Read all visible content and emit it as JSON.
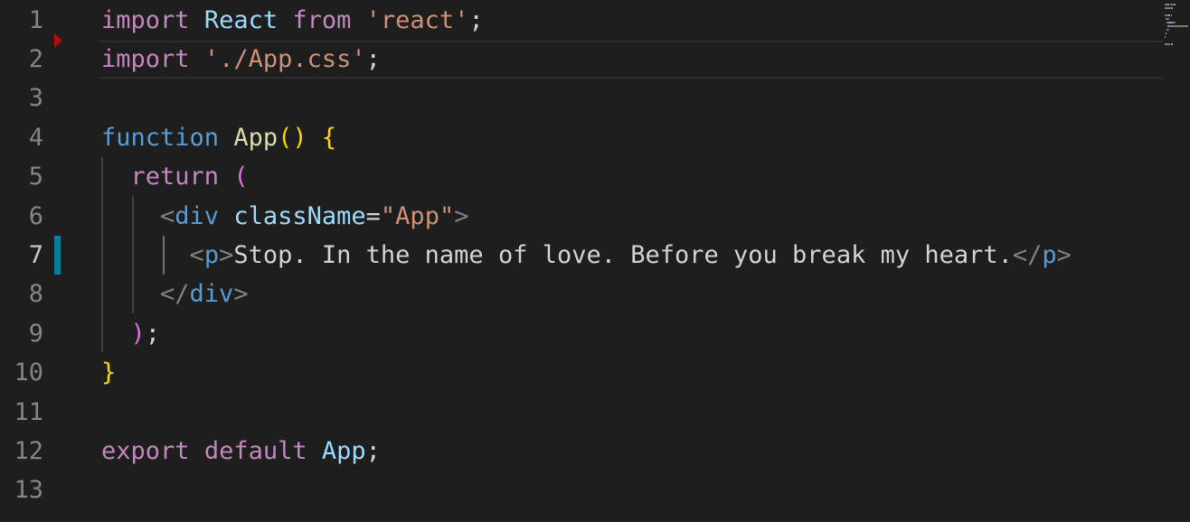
{
  "editor": {
    "active_line": 7,
    "colors": {
      "background": "#1e1e1e",
      "line_number": "#858585",
      "keyword": "#c586c0",
      "declaration": "#569cd6",
      "variable": "#9cdcfe",
      "function": "#dcdcaa",
      "string": "#ce9178",
      "bracket_level_1": "#ffd700",
      "bracket_level_2": "#da70d6",
      "breakpoint": "#b10d0d",
      "git_modified": "#0c7d9d"
    },
    "line_numbers": [
      "1",
      "2",
      "3",
      "4",
      "5",
      "6",
      "7",
      "8",
      "9",
      "10",
      "11",
      "12",
      "13"
    ],
    "lines": [
      {
        "tokens": [
          {
            "t": "keyword",
            "v": "import"
          },
          {
            "t": "text",
            "v": " "
          },
          {
            "t": "var",
            "v": "React"
          },
          {
            "t": "text",
            "v": " "
          },
          {
            "t": "keyword",
            "v": "from"
          },
          {
            "t": "text",
            "v": " "
          },
          {
            "t": "string",
            "v": "'react'"
          },
          {
            "t": "punct",
            "v": ";"
          }
        ]
      },
      {
        "tokens": [
          {
            "t": "keyword",
            "v": "import"
          },
          {
            "t": "text",
            "v": " "
          },
          {
            "t": "string",
            "v": "'./App.css'"
          },
          {
            "t": "punct",
            "v": ";"
          }
        ]
      },
      {
        "tokens": []
      },
      {
        "tokens": [
          {
            "t": "decl",
            "v": "function"
          },
          {
            "t": "text",
            "v": " "
          },
          {
            "t": "func",
            "v": "App"
          },
          {
            "t": "bracket1",
            "v": "()"
          },
          {
            "t": "text",
            "v": " "
          },
          {
            "t": "bracket1",
            "v": "{"
          }
        ]
      },
      {
        "tokens": [
          {
            "t": "text",
            "v": "  "
          },
          {
            "t": "keyword",
            "v": "return"
          },
          {
            "t": "text",
            "v": " "
          },
          {
            "t": "bracket2",
            "v": "("
          }
        ]
      },
      {
        "tokens": [
          {
            "t": "text",
            "v": "    "
          },
          {
            "t": "tag-bracket",
            "v": "<"
          },
          {
            "t": "tag",
            "v": "div"
          },
          {
            "t": "text",
            "v": " "
          },
          {
            "t": "attr",
            "v": "className"
          },
          {
            "t": "punct",
            "v": "="
          },
          {
            "t": "string",
            "v": "\"App\""
          },
          {
            "t": "tag-bracket",
            "v": ">"
          }
        ]
      },
      {
        "tokens": [
          {
            "t": "text",
            "v": "      "
          },
          {
            "t": "tag-bracket",
            "v": "<"
          },
          {
            "t": "tag",
            "v": "p"
          },
          {
            "t": "tag-bracket",
            "v": ">"
          },
          {
            "t": "text",
            "v": "Stop. In the name of love. Before you break my heart."
          },
          {
            "t": "tag-bracket",
            "v": "</"
          },
          {
            "t": "tag",
            "v": "p"
          },
          {
            "t": "tag-bracket",
            "v": ">"
          }
        ]
      },
      {
        "tokens": [
          {
            "t": "text",
            "v": "    "
          },
          {
            "t": "tag-bracket",
            "v": "</"
          },
          {
            "t": "tag",
            "v": "div"
          },
          {
            "t": "tag-bracket",
            "v": ">"
          }
        ]
      },
      {
        "tokens": [
          {
            "t": "text",
            "v": "  "
          },
          {
            "t": "bracket2",
            "v": ")"
          },
          {
            "t": "punct",
            "v": ";"
          }
        ]
      },
      {
        "tokens": [
          {
            "t": "bracket1",
            "v": "}"
          }
        ]
      },
      {
        "tokens": []
      },
      {
        "tokens": [
          {
            "t": "keyword",
            "v": "export"
          },
          {
            "t": "text",
            "v": " "
          },
          {
            "t": "keyword",
            "v": "default"
          },
          {
            "t": "text",
            "v": " "
          },
          {
            "t": "var",
            "v": "App"
          },
          {
            "t": "punct",
            "v": ";"
          }
        ]
      },
      {
        "tokens": []
      }
    ]
  }
}
